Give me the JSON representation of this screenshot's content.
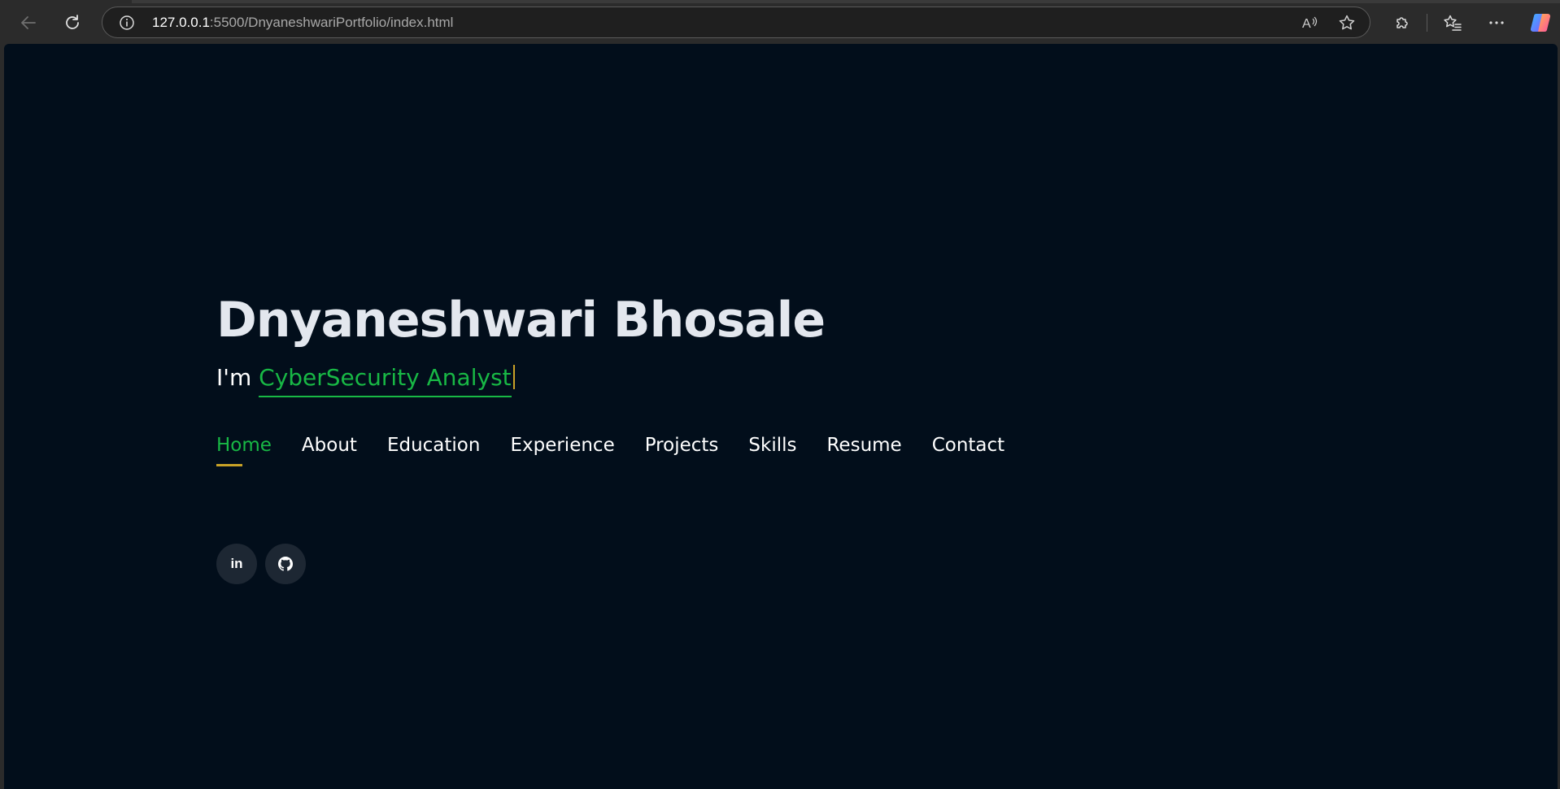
{
  "browser": {
    "url_host": "127.0.0.1",
    "url_rest": ":5500/DnyaneshwariPortfolio/index.html",
    "icons": {
      "back": "back-arrow-icon",
      "refresh": "refresh-icon",
      "site_info": "info-icon",
      "read_aloud": "read-aloud-icon",
      "favorite": "star-icon",
      "extensions": "puzzle-icon",
      "favorites": "favorites-list-icon",
      "more": "more-icon",
      "copilot": "copilot-icon"
    }
  },
  "hero": {
    "name": "Dnyaneshwari Bhosale",
    "tagline_prefix": "I'm ",
    "tagline_typed": "CyberSecurity Analyst"
  },
  "nav": {
    "items": [
      {
        "label": "Home",
        "active": true
      },
      {
        "label": "About"
      },
      {
        "label": "Education"
      },
      {
        "label": "Experience"
      },
      {
        "label": "Projects"
      },
      {
        "label": "Skills"
      },
      {
        "label": "Resume"
      },
      {
        "label": "Contact"
      }
    ]
  },
  "social": {
    "linkedin_label": "in",
    "github_icon": "github-icon"
  },
  "colors": {
    "background": "#020e1b",
    "accent_green": "#18b845",
    "underline_gold": "#c9a227",
    "name_text": "#e3e7ee",
    "social_bg": "#1d2733"
  }
}
